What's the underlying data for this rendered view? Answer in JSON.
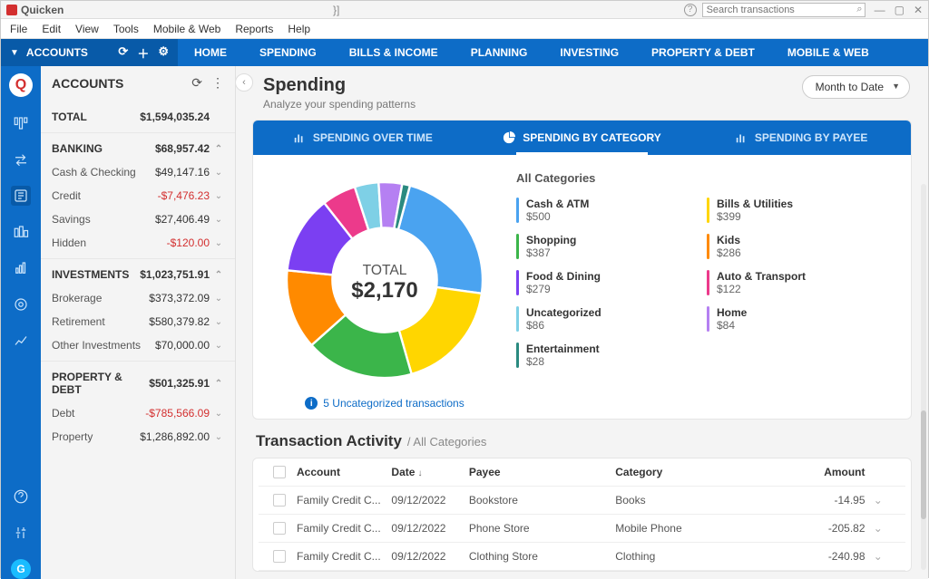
{
  "app_title": "Quicken",
  "title_hint": "}]",
  "search_placeholder": "Search transactions",
  "menu": [
    "File",
    "Edit",
    "View",
    "Tools",
    "Mobile & Web",
    "Reports",
    "Help"
  ],
  "topnav": {
    "accounts_label": "ACCOUNTS",
    "tabs": [
      "HOME",
      "SPENDING",
      "BILLS & INCOME",
      "PLANNING",
      "INVESTING",
      "PROPERTY & DEBT",
      "MOBILE & WEB"
    ]
  },
  "sidebar": {
    "title": "ACCOUNTS",
    "total_label": "TOTAL",
    "total_value": "$1,594,035.24",
    "groups": [
      {
        "name": "BANKING",
        "value": "$68,957.42",
        "items": [
          {
            "name": "Cash & Checking",
            "value": "$49,147.16",
            "neg": false
          },
          {
            "name": "Credit",
            "value": "-$7,476.23",
            "neg": true
          },
          {
            "name": "Savings",
            "value": "$27,406.49",
            "neg": false
          },
          {
            "name": "Hidden",
            "value": "-$120.00",
            "neg": true
          }
        ]
      },
      {
        "name": "INVESTMENTS",
        "value": "$1,023,751.91",
        "items": [
          {
            "name": "Brokerage",
            "value": "$373,372.09",
            "neg": false
          },
          {
            "name": "Retirement",
            "value": "$580,379.82",
            "neg": false
          },
          {
            "name": "Other Investments",
            "value": "$70,000.00",
            "neg": false
          }
        ]
      },
      {
        "name": "PROPERTY & DEBT",
        "value": "$501,325.91",
        "items": [
          {
            "name": "Debt",
            "value": "-$785,566.09",
            "neg": true
          },
          {
            "name": "Property",
            "value": "$1,286,892.00",
            "neg": false
          }
        ]
      }
    ]
  },
  "page": {
    "title": "Spending",
    "subtitle": "Analyze your spending patterns",
    "range": "Month to Date",
    "subtabs": [
      "SPENDING OVER TIME",
      "SPENDING BY CATEGORY",
      "SPENDING BY PAYEE"
    ],
    "active_subtab": 1,
    "total_label": "TOTAL",
    "total_value": "$2,170",
    "uncat_link": "5 Uncategorized transactions",
    "legend_title": "All Categories"
  },
  "chart_data": {
    "type": "pie",
    "title": "Spending by Category",
    "total_label": "TOTAL",
    "total_value": 2170,
    "series": [
      {
        "name": "Cash & ATM",
        "value": 500,
        "color": "#4aa3f0"
      },
      {
        "name": "Bills & Utilities",
        "value": 399,
        "color": "#ffd600"
      },
      {
        "name": "Shopping",
        "value": 387,
        "color": "#3bb54a"
      },
      {
        "name": "Kids",
        "value": 286,
        "color": "#ff8a00"
      },
      {
        "name": "Food & Dining",
        "value": 279,
        "color": "#7b3ff2"
      },
      {
        "name": "Auto & Transport",
        "value": 122,
        "color": "#ec3a8b"
      },
      {
        "name": "Uncategorized",
        "value": 86,
        "color": "#7ed0e6"
      },
      {
        "name": "Home",
        "value": 84,
        "color": "#b580f2"
      },
      {
        "name": "Entertainment",
        "value": 28,
        "color": "#2a8a80"
      }
    ]
  },
  "legend_layout": {
    "left": [
      0,
      2,
      4,
      6,
      8
    ],
    "right": [
      1,
      3,
      5,
      7
    ]
  },
  "transactions": {
    "heading": "Transaction Activity",
    "breadcrumb": "/ All Categories",
    "columns": {
      "account": "Account",
      "date": "Date",
      "payee": "Payee",
      "category": "Category",
      "amount": "Amount"
    },
    "rows": [
      {
        "account": "Family Credit C...",
        "date": "09/12/2022",
        "payee": "Bookstore",
        "category": "Books",
        "amount": "-14.95"
      },
      {
        "account": "Family Credit C...",
        "date": "09/12/2022",
        "payee": "Phone Store",
        "category": "Mobile Phone",
        "amount": "-205.82"
      },
      {
        "account": "Family Credit C...",
        "date": "09/12/2022",
        "payee": "Clothing Store",
        "category": "Clothing",
        "amount": "-240.98"
      }
    ]
  }
}
